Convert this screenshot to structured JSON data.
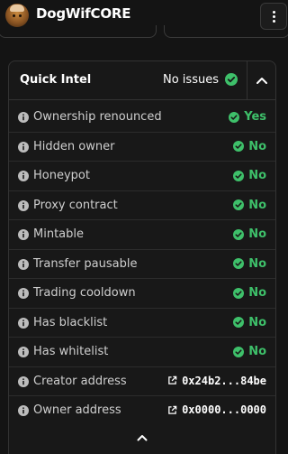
{
  "header": {
    "token_name": "DogWifCORE",
    "avatar_icon": "dog-avatar",
    "menu_icon": "kebab-menu-icon"
  },
  "quick_intel": {
    "title": "Quick Intel",
    "summary": "No issues",
    "summary_icon": "check-circle-icon",
    "collapse_icon": "chevron-up-icon",
    "ok_color": "#3ec06a",
    "rows": [
      {
        "label": "Ownership renounced",
        "value": "Yes"
      },
      {
        "label": "Hidden owner",
        "value": "No"
      },
      {
        "label": "Honeypot",
        "value": "No"
      },
      {
        "label": "Proxy contract",
        "value": "No"
      },
      {
        "label": "Mintable",
        "value": "No"
      },
      {
        "label": "Transfer pausable",
        "value": "No"
      },
      {
        "label": "Trading cooldown",
        "value": "No"
      },
      {
        "label": "Has blacklist",
        "value": "No"
      },
      {
        "label": "Has whitelist",
        "value": "No"
      }
    ],
    "addresses": [
      {
        "label": "Creator address",
        "value": "0x24b2...84be",
        "icon": "external-link-icon"
      },
      {
        "label": "Owner address",
        "value": "0x0000...0000",
        "icon": "external-link-icon"
      }
    ],
    "scroll_icon": "chevron-up-icon"
  }
}
